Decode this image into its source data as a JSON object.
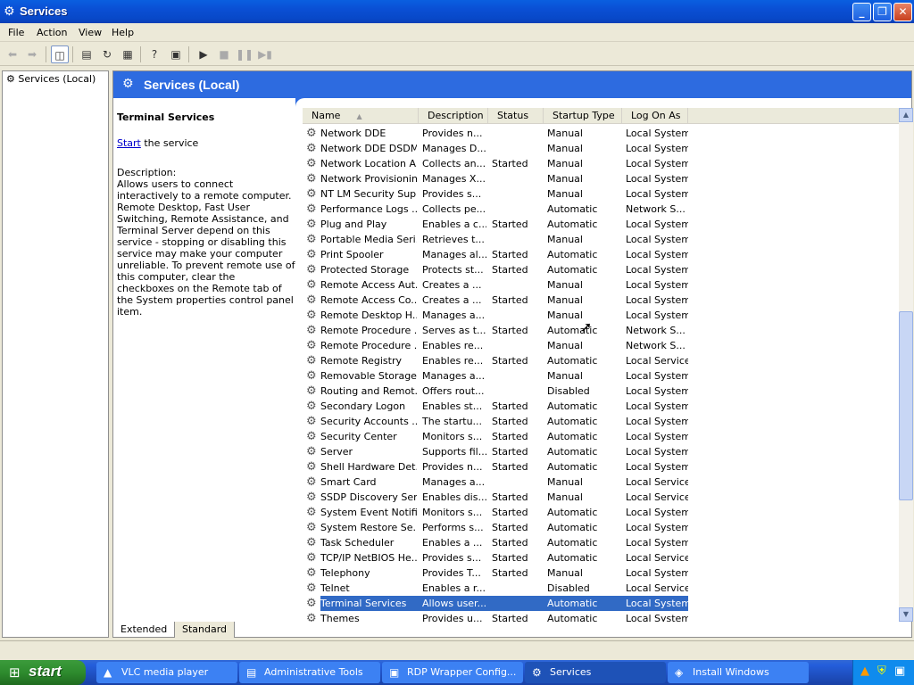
{
  "window": {
    "title": "Services"
  },
  "menu": [
    "File",
    "Action",
    "View",
    "Help"
  ],
  "tree": {
    "root": "Services (Local)"
  },
  "banner": {
    "title": "Services (Local)"
  },
  "details": {
    "title": "Terminal Services",
    "start_link": "Start",
    "start_rest": " the service",
    "desc_label": "Description:",
    "desc_text": "Allows users to connect interactively to a remote computer. Remote Desktop, Fast User Switching, Remote Assistance, and Terminal Server depend on this service - stopping or disabling this service may make your computer unreliable.  To prevent remote use of this computer, clear the checkboxes on the Remote tab of the System properties control panel item."
  },
  "columns": [
    "Name",
    "Description",
    "Status",
    "Startup Type",
    "Log On As"
  ],
  "rows": [
    [
      "Network DDE",
      "Provides n...",
      "",
      "Manual",
      "Local System"
    ],
    [
      "Network DDE DSDM",
      "Manages D...",
      "",
      "Manual",
      "Local System"
    ],
    [
      "Network Location A...",
      "Collects an...",
      "Started",
      "Manual",
      "Local System"
    ],
    [
      "Network Provisionin...",
      "Manages X...",
      "",
      "Manual",
      "Local System"
    ],
    [
      "NT LM Security Sup...",
      "Provides s...",
      "",
      "Manual",
      "Local System"
    ],
    [
      "Performance Logs ...",
      "Collects pe...",
      "",
      "Automatic",
      "Network S..."
    ],
    [
      "Plug and Play",
      "Enables a c...",
      "Started",
      "Automatic",
      "Local System"
    ],
    [
      "Portable Media Seri...",
      "Retrieves t...",
      "",
      "Manual",
      "Local System"
    ],
    [
      "Print Spooler",
      "Manages al...",
      "Started",
      "Automatic",
      "Local System"
    ],
    [
      "Protected Storage",
      "Protects st...",
      "Started",
      "Automatic",
      "Local System"
    ],
    [
      "Remote Access Aut...",
      "Creates a ...",
      "",
      "Manual",
      "Local System"
    ],
    [
      "Remote Access Co...",
      "Creates a ...",
      "Started",
      "Manual",
      "Local System"
    ],
    [
      "Remote Desktop H...",
      "Manages a...",
      "",
      "Manual",
      "Local System"
    ],
    [
      "Remote Procedure ...",
      "Serves as t...",
      "Started",
      "Automatic",
      "Network S..."
    ],
    [
      "Remote Procedure ...",
      "Enables re...",
      "",
      "Manual",
      "Network S..."
    ],
    [
      "Remote Registry",
      "Enables re...",
      "Started",
      "Automatic",
      "Local Service"
    ],
    [
      "Removable Storage",
      "Manages a...",
      "",
      "Manual",
      "Local System"
    ],
    [
      "Routing and Remot...",
      "Offers rout...",
      "",
      "Disabled",
      "Local System"
    ],
    [
      "Secondary Logon",
      "Enables st...",
      "Started",
      "Automatic",
      "Local System"
    ],
    [
      "Security Accounts ...",
      "The startu...",
      "Started",
      "Automatic",
      "Local System"
    ],
    [
      "Security Center",
      "Monitors s...",
      "Started",
      "Automatic",
      "Local System"
    ],
    [
      "Server",
      "Supports fil...",
      "Started",
      "Automatic",
      "Local System"
    ],
    [
      "Shell Hardware Det...",
      "Provides n...",
      "Started",
      "Automatic",
      "Local System"
    ],
    [
      "Smart Card",
      "Manages a...",
      "",
      "Manual",
      "Local Service"
    ],
    [
      "SSDP Discovery Ser...",
      "Enables dis...",
      "Started",
      "Manual",
      "Local Service"
    ],
    [
      "System Event Notifi...",
      "Monitors s...",
      "Started",
      "Automatic",
      "Local System"
    ],
    [
      "System Restore Se...",
      "Performs s...",
      "Started",
      "Automatic",
      "Local System"
    ],
    [
      "Task Scheduler",
      "Enables a ...",
      "Started",
      "Automatic",
      "Local System"
    ],
    [
      "TCP/IP NetBIOS He...",
      "Provides s...",
      "Started",
      "Automatic",
      "Local Service"
    ],
    [
      "Telephony",
      "Provides T...",
      "Started",
      "Manual",
      "Local System"
    ],
    [
      "Telnet",
      "Enables a r...",
      "",
      "Disabled",
      "Local Service"
    ],
    [
      "Terminal Services",
      "Allows user...",
      "",
      "Automatic",
      "Local System"
    ],
    [
      "Themes",
      "Provides u...",
      "Started",
      "Automatic",
      "Local System"
    ]
  ],
  "selected_row": 31,
  "tabs": [
    "Extended",
    "Standard"
  ],
  "taskbar": {
    "start": "start",
    "items": [
      "VLC media player",
      "Administrative Tools",
      "RDP Wrapper Config...",
      "Services",
      "Install Windows"
    ],
    "active": 3
  },
  "colors": {
    "selection": "#316ac5",
    "banner": "#2d6be0",
    "titlebar": "#0a4fd4"
  },
  "icons": [
    "gear-icon",
    "back-arrow-icon",
    "forward-arrow-icon",
    "play-icon",
    "stop-icon",
    "pause-icon"
  ]
}
